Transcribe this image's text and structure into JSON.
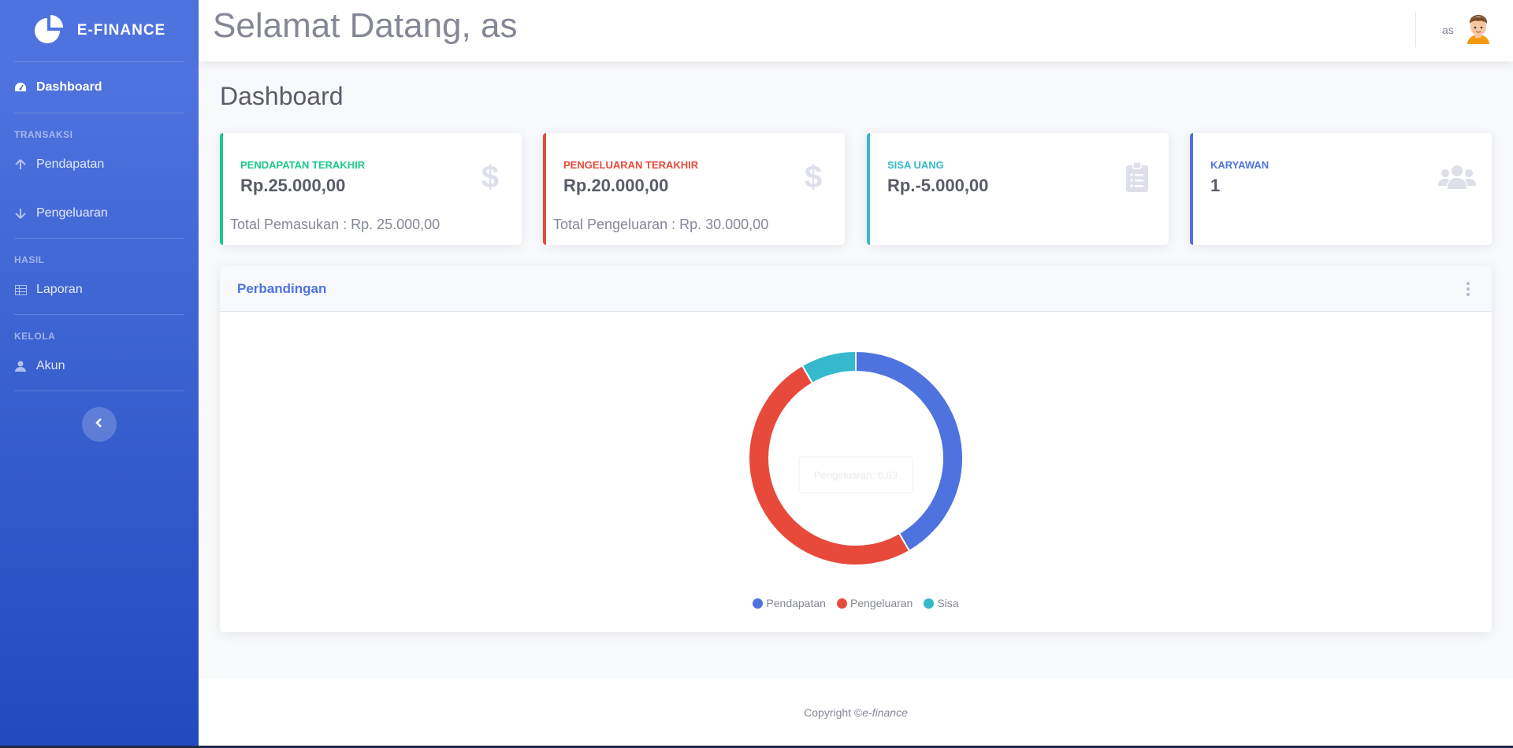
{
  "brand": {
    "name": "E-FINANCE"
  },
  "sidebar": {
    "dashboard": "Dashboard",
    "sections": [
      {
        "heading": "TRANSAKSI"
      },
      {
        "heading": "HASIL"
      },
      {
        "heading": "KELOLA"
      }
    ],
    "items": {
      "pendapatan": "Pendapatan",
      "pengeluaran": "Pengeluaran",
      "laporan": "Laporan",
      "akun": "Akun"
    }
  },
  "topbar": {
    "welcome": "Selamat Datang, as",
    "user": "as"
  },
  "page": {
    "title": "Dashboard"
  },
  "cards": [
    {
      "label": "PENDAPATAN TERAKHIR",
      "value": "Rp.25.000,00",
      "sub": "Total Pemasukan : Rp. 25.000,00",
      "color": "#1cc88a",
      "icon": "dollar-icon"
    },
    {
      "label": "PENGELUARAN TERAKHIR",
      "value": "Rp.20.000,00",
      "sub": "Total Pengeluaran : Rp. 30.000,00",
      "color": "#e74a3b",
      "icon": "dollar-icon"
    },
    {
      "label": "SISA UANG",
      "value": "Rp.-5.000,00",
      "sub": "",
      "color": "#36b9cc",
      "icon": "clipboard-list-icon"
    },
    {
      "label": "KARYAWAN",
      "value": "1",
      "sub": "",
      "color": "#4e73df",
      "icon": "users-icon"
    }
  ],
  "panel": {
    "title": "Perbandingan"
  },
  "chart_data": {
    "type": "doughnut",
    "tooltip": "Pengeluaran: 0.03",
    "series": [
      {
        "name": "Pendapatan",
        "value": 25000,
        "color": "#4e73df"
      },
      {
        "name": "Pengeluaran",
        "value": 30000,
        "color": "#e74a3b"
      },
      {
        "name": "Sisa",
        "value": 5000,
        "color": "#36b9cc"
      }
    ]
  },
  "footer": {
    "prefix": "Copyright © ",
    "brand": "e-finance"
  }
}
